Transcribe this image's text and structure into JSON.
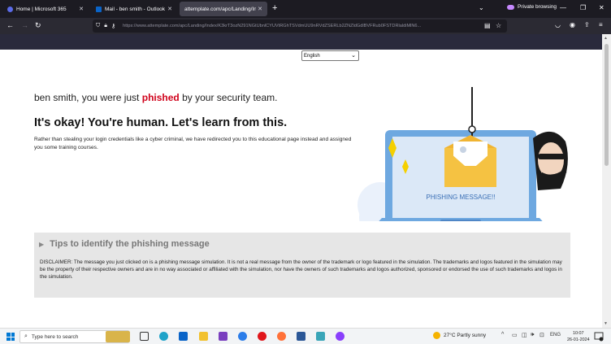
{
  "browser": {
    "tabs": [
      {
        "label": "Home | Microsoft 365",
        "icon": "microsoft365-icon",
        "icon_color": "#5b6be8"
      },
      {
        "label": "Mail - ben smith - Outlook",
        "icon": "outlook-icon",
        "icon_color": "#0a64c8"
      },
      {
        "label": "attemplate.com/apc/Landing/Inde",
        "icon": "",
        "icon_color": "",
        "active": true
      }
    ],
    "private_label": "Private browsing",
    "url": "https://www.attemplate.com/apc/Landing/Index/K3krT3ozN291NGtUbnlCYUVtRGhTSVdmUU9nRVdZSERLb2ZNZldGdlBVFRub0FSTDRlaldiMlN6..."
  },
  "page": {
    "language_select": {
      "value": "English"
    },
    "greeting_prefix": "ben smith, you were just ",
    "greeting_emph": "phished",
    "greeting_suffix": " by your security team.",
    "headline": "It's okay! You're human. Let's learn from this.",
    "description": "Rather than stealing your login credentials like a cyber criminal, we have redirected you to this educational page instead and assigned you some training courses.",
    "illustration": {
      "screen_text": "PHISHING MESSAGE!!"
    },
    "tips": {
      "title": "Tips to identify the phishing message",
      "disclaimer": "DISCLAIMER: The message you just clicked on is a phishing message simulation. It is not a real message from the owner of the trademark or logo featured in the simulation. The trademarks and logos featured in the simulation may be the property of their respective owners and are in no way associated or affiliated with the simulation, nor have the owners of such trademarks and logos authorized, sponsored or endorsed the use of such trademarks and logos in the simulation."
    }
  },
  "taskbar": {
    "search_placeholder": "Type here to search",
    "weather": "27°C  Partly sunny",
    "lang": "ENG",
    "time": "10:07",
    "date": "26-01-2024"
  },
  "colors": {
    "phished_red": "#d0021b",
    "laptop_blue": "#6ea8e0",
    "envelope_yellow": "#f5c242",
    "top_band": "#2a2a3c"
  }
}
